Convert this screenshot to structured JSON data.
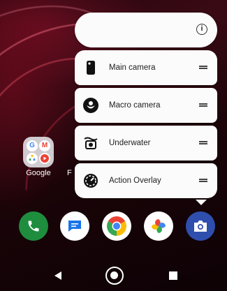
{
  "shortcuts": [
    {
      "label": "Main camera",
      "icon": "phone-camera-icon"
    },
    {
      "label": "Macro camera",
      "icon": "flower-icon"
    },
    {
      "label": "Underwater",
      "icon": "underwater-camera-icon"
    },
    {
      "label": "Action Overlay",
      "icon": "speedometer-icon"
    }
  ],
  "folder": {
    "label": "Google",
    "apps": [
      "G",
      "M",
      "Drive",
      "YouTube"
    ]
  },
  "partial_label": "F",
  "dock": [
    "Phone",
    "Messages",
    "Chrome",
    "Photos",
    "Camera"
  ],
  "colors": {
    "camera_blue": "#2f4fae",
    "phone_green": "#1e8e3e",
    "messages_blue": "#1a73e8"
  }
}
